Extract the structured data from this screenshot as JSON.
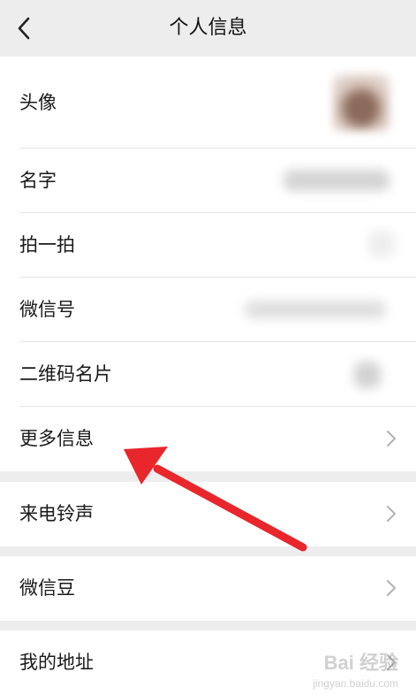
{
  "nav": {
    "title": "个人信息",
    "back_icon": "chevron-left-icon"
  },
  "group1": {
    "rows": [
      {
        "label": "头像"
      },
      {
        "label": "名字"
      },
      {
        "label": "拍一拍"
      },
      {
        "label": "微信号"
      },
      {
        "label": "二维码名片"
      },
      {
        "label": "更多信息"
      }
    ]
  },
  "group2": {
    "rows": [
      {
        "label": "来电铃声"
      }
    ]
  },
  "group3": {
    "rows": [
      {
        "label": "微信豆"
      }
    ]
  },
  "group4": {
    "rows": [
      {
        "label": "我的地址"
      }
    ]
  },
  "annotation": {
    "arrow_color": "#e8262b"
  },
  "watermark": {
    "text": "Bai 经验",
    "sub": "jingyan.baidu.com"
  },
  "colors": {
    "background": "#ededed",
    "row_background": "#ffffff",
    "text": "#191919",
    "chevron": "#b2b2b2"
  }
}
